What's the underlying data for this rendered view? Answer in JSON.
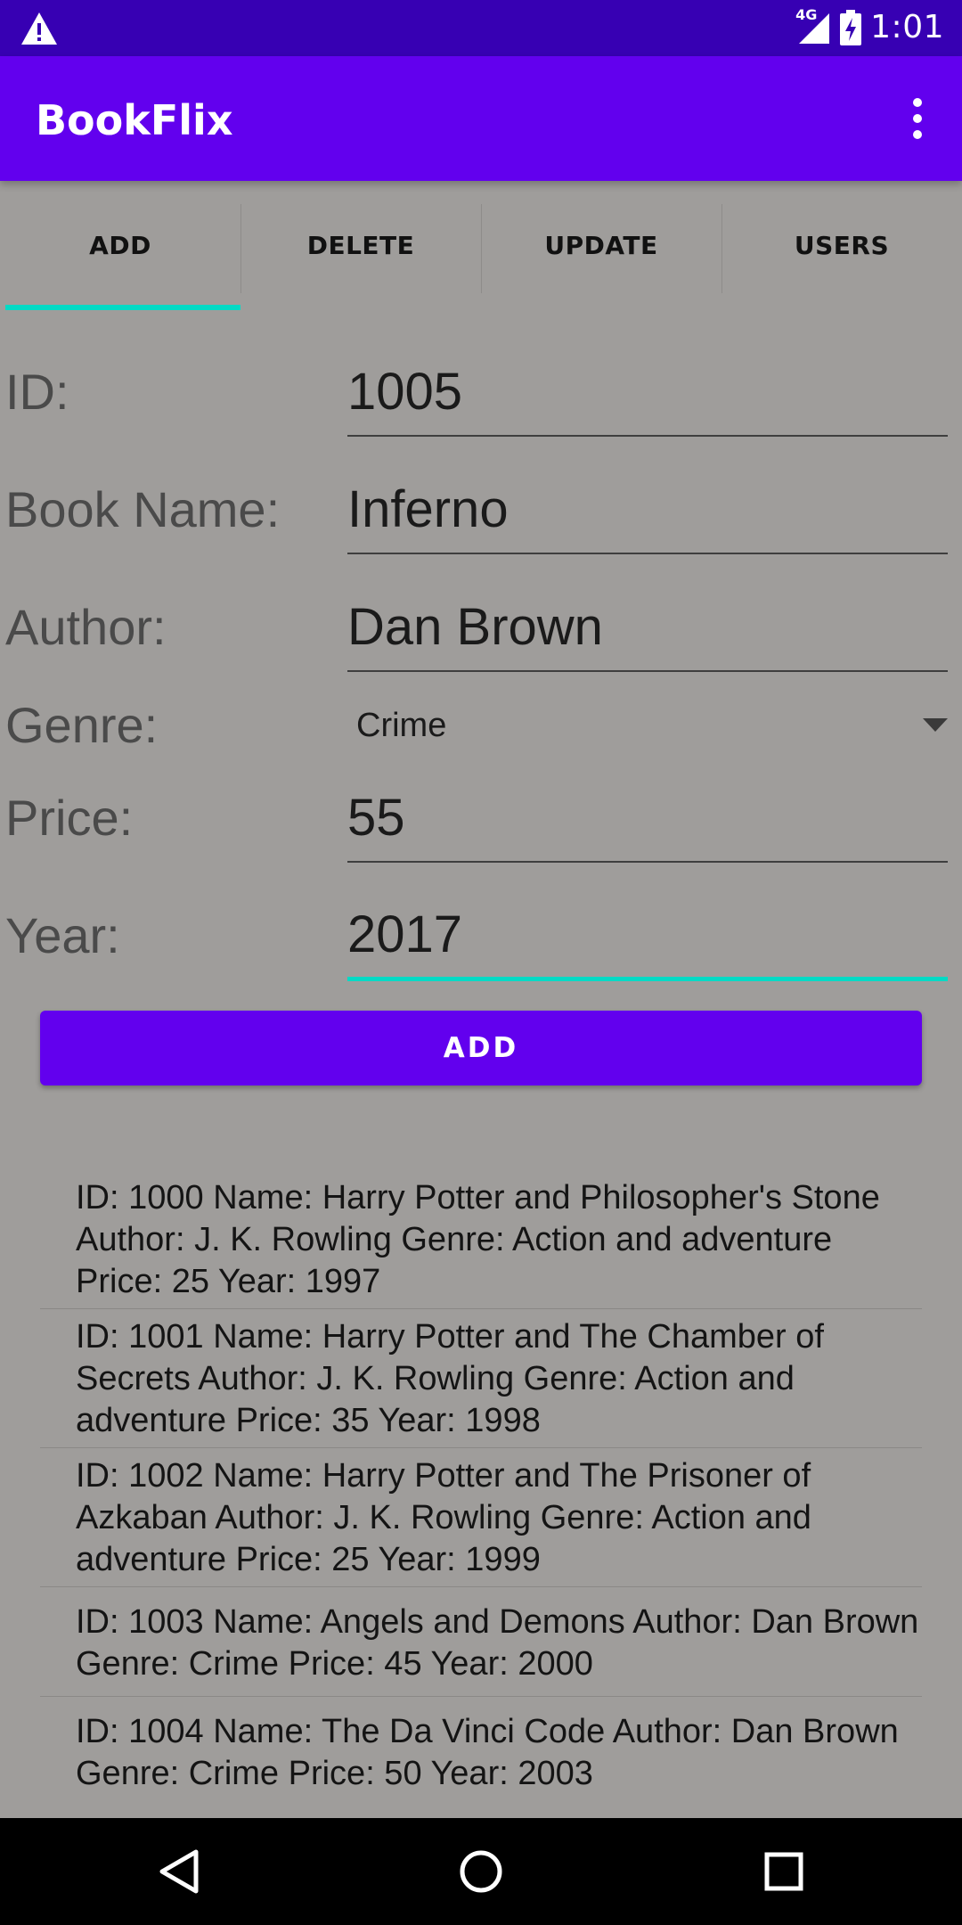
{
  "status_bar": {
    "time": "1:01",
    "network": "4G",
    "icons": [
      "warning-icon",
      "signal-icon",
      "battery-charging-icon"
    ]
  },
  "app_bar": {
    "title": "BookFlix",
    "menu_icon": "more-vert-icon"
  },
  "tabs": [
    {
      "label": "ADD",
      "active": true
    },
    {
      "label": "DELETE",
      "active": false
    },
    {
      "label": "UPDATE",
      "active": false
    },
    {
      "label": "USERS",
      "active": false
    }
  ],
  "form": {
    "id": {
      "label": "ID:",
      "value": "1005"
    },
    "book_name": {
      "label": "Book Name:",
      "value": "Inferno"
    },
    "author": {
      "label": "Author:",
      "value": "Dan Brown"
    },
    "genre": {
      "label": "Genre:",
      "value": "Crime"
    },
    "price": {
      "label": "Price:",
      "value": "55"
    },
    "year": {
      "label": "Year:",
      "value": "2017"
    }
  },
  "add_button_label": "ADD",
  "books": [
    "ID: 1000 Name: Harry Potter and Philosopher's Stone Author: J. K. Rowling Genre: Action and adventure Price: 25 Year: 1997",
    "ID: 1001 Name: Harry Potter and The Chamber of Secrets Author: J. K. Rowling Genre: Action and adventure Price: 35 Year: 1998",
    "ID: 1002 Name: Harry Potter and The Prisoner of Azkaban Author: J. K. Rowling Genre: Action and adventure Price: 25 Year: 1999",
    "ID: 1003 Name: Angels and Demons Author: Dan Brown Genre: Crime Price: 45 Year: 2000",
    "ID: 1004 Name: The Da Vinci Code Author: Dan Brown Genre: Crime Price: 50 Year: 2003"
  ],
  "colors": {
    "status_bar": "#3700b3",
    "primary": "#6200ee",
    "accent": "#03dac5",
    "background": "#9f9d9b"
  },
  "nav_bar": {
    "icons": [
      "back-icon",
      "home-icon",
      "recents-icon"
    ]
  }
}
